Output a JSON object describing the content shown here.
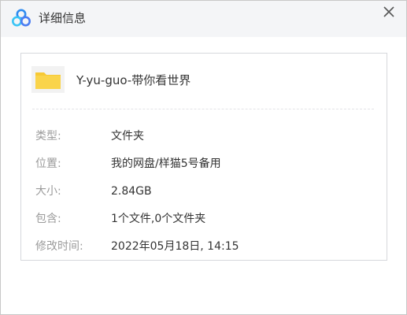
{
  "window": {
    "title": "详细信息",
    "icon": "baidu-netdisk-icon",
    "close_icon": "close-icon"
  },
  "file": {
    "icon": "folder-icon",
    "name": "Y-yu-guo-带你看世界"
  },
  "details": [
    {
      "label": "类型:",
      "value": "文件夹"
    },
    {
      "label": "位置:",
      "value": "我的网盘/样猫5号备用"
    },
    {
      "label": "大小:",
      "value": "2.84GB"
    },
    {
      "label": "包含:",
      "value": "1个文件,0个文件夹"
    },
    {
      "label": "修改时间:",
      "value": "2022年05月18日, 14:15"
    }
  ],
  "colors": {
    "titlebar_bg": "#f4f5f7",
    "folder": "#f7c935",
    "label": "#9b9b9b",
    "text": "#333333"
  }
}
